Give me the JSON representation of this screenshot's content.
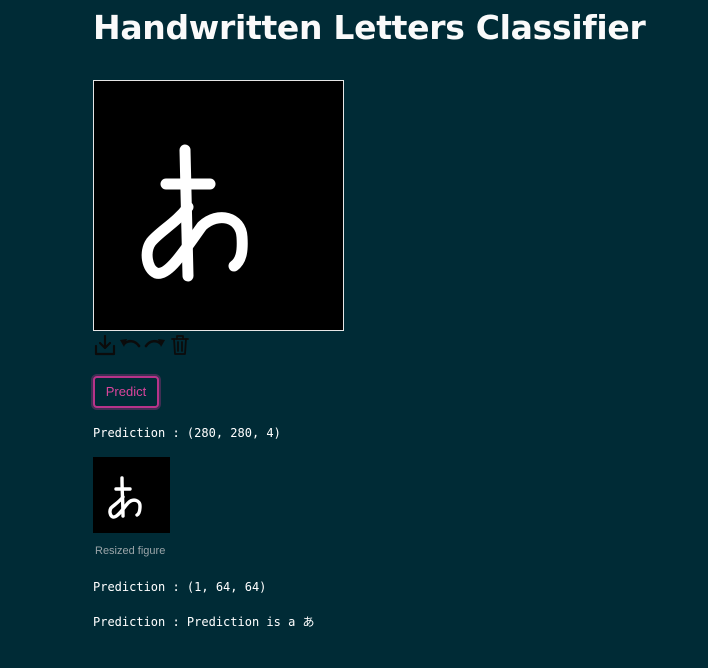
{
  "app": {
    "title": "Handwritten Letters Classifier"
  },
  "canvas": {
    "drawn_character": "あ",
    "background_color": "#000000",
    "stroke_color": "#ffffff"
  },
  "toolbar": {
    "icons": [
      "download-icon",
      "undo-icon",
      "redo-icon",
      "trash-icon"
    ]
  },
  "predict_button": {
    "label": "Predict",
    "accent_color": "#d9449b"
  },
  "outputs": {
    "line1": "Prediction : (280, 280, 4)",
    "resized_caption": "Resized figure",
    "line2": "Prediction : (1, 64, 64)",
    "line3": "Prediction : Prediction is a あ"
  },
  "theme": {
    "background": "#002b36",
    "text": "#ffffff"
  }
}
